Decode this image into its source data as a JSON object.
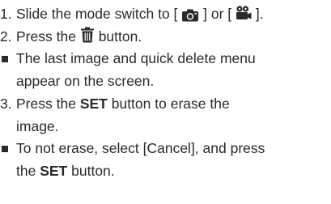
{
  "steps": [
    {
      "num": "1.",
      "text_a": "Slide the mode switch to [",
      "text_b": "] or [",
      "text_c": "]."
    },
    {
      "num": "2.",
      "text_a": "Press the",
      "text_b": "button."
    },
    {
      "bullet_line1": "The last image and quick delete menu",
      "bullet_line2": "appear on the screen."
    },
    {
      "num": "3.",
      "text_a": "Press the",
      "bold": "SET",
      "text_b": "button to erase the",
      "line2": "image."
    },
    {
      "bullet_line1": "To not erase, select [Cancel], and press",
      "bullet_line2_pre": "the",
      "bullet_line2_bold": "SET",
      "bullet_line2_post": "button."
    }
  ],
  "icons": {
    "photo_mode": "camera-icon",
    "movie_mode": "movie-camera-icon",
    "delete": "trash-icon"
  }
}
